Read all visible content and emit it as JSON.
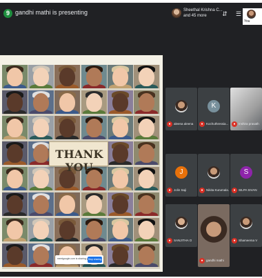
{
  "top_bar": {
    "participant_count_badge": "9",
    "presenting_text": "gandhi mathi is presenting",
    "participants_line1": "Sheethal Krishna C...",
    "participants_line2": "and 45 more",
    "self_label": "You"
  },
  "slide": {
    "thank_you_text": "THANK YOU",
    "share_bar_text": "meetgoogle.com is sharing your screen.",
    "stop_sharing_label": "Stop sharing"
  },
  "participants": [
    {
      "name": "aleena aleena",
      "avatar_type": "photo"
    },
    {
      "name": "Kochuthressia...",
      "avatar_letter": "K",
      "avatar_color": "#78909c"
    },
    {
      "name": "Inshira prasath",
      "avatar_type": "video"
    },
    {
      "name": "Jolin Saji",
      "avatar_letter": "J",
      "avatar_color": "#e8710a"
    },
    {
      "name": "Nikita Kurumala...",
      "avatar_type": "photo"
    },
    {
      "name": "SILPA SIVAN",
      "avatar_letter": "S",
      "avatar_color": "#8e24aa"
    },
    {
      "name": "SANJITHA O",
      "avatar_type": "photo"
    },
    {
      "name": "gandhi mathi",
      "avatar_type": "video"
    },
    {
      "name": "Shameema V",
      "avatar_type": "photo"
    }
  ],
  "colors": {
    "call_background": "#202124",
    "tile_background": "#3c4043",
    "muted_mic": "#d93025",
    "presenter_badge": "#1e8e3e",
    "stop_button": "#1a73e8"
  }
}
